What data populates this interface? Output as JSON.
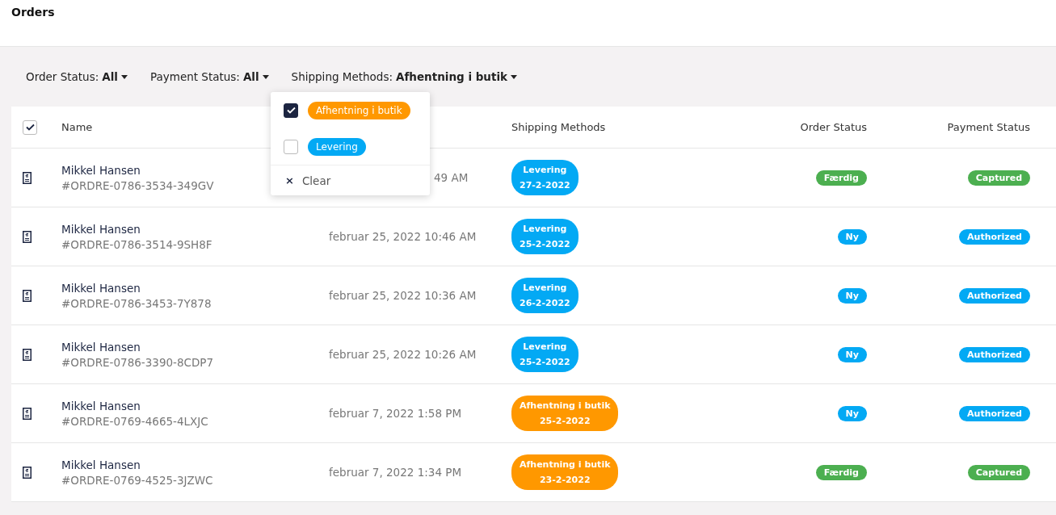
{
  "title": "Orders",
  "filters": [
    {
      "label": "Order Status:",
      "value": "All"
    },
    {
      "label": "Payment Status:",
      "value": "All"
    },
    {
      "label": "Shipping Methods:",
      "value": "Afhentning i butik"
    }
  ],
  "dropdown": {
    "options": [
      {
        "label": "Afhentning i butik",
        "checked": true,
        "color": "#ff9800"
      },
      {
        "label": "Levering",
        "checked": false,
        "color": "#03a9f4"
      }
    ],
    "clear": {
      "icon": "×",
      "label": "Clear"
    }
  },
  "table": {
    "select_all": {
      "checked": true
    },
    "columns": [
      "Name",
      "Shipping Methods",
      "Order Status",
      "Payment Status"
    ],
    "rows": [
      {
        "name": "Mikkel Hansen",
        "order": "#ORDRE-0786-3534-349GV",
        "date": "49 AM",
        "date_cut": true,
        "shipping": {
          "method": "Levering",
          "date": "27-2-2022",
          "color": "#03a9f4"
        },
        "order_status": {
          "label": "Færdig",
          "color": "#4caf50"
        },
        "payment_status": {
          "label": "Captured",
          "color": "#4caf50"
        }
      },
      {
        "name": "Mikkel Hansen",
        "order": "#ORDRE-0786-3514-9SH8F",
        "date": "februar 25, 2022 10:46 AM",
        "date_cut": false,
        "shipping": {
          "method": "Levering",
          "date": "25-2-2022",
          "color": "#03a9f4"
        },
        "order_status": {
          "label": "Ny",
          "color": "#03a9f4"
        },
        "payment_status": {
          "label": "Authorized",
          "color": "#03a9f4"
        }
      },
      {
        "name": "Mikkel Hansen",
        "order": "#ORDRE-0786-3453-7Y878",
        "date": "februar 25, 2022 10:36 AM",
        "date_cut": false,
        "shipping": {
          "method": "Levering",
          "date": "26-2-2022",
          "color": "#03a9f4"
        },
        "order_status": {
          "label": "Ny",
          "color": "#03a9f4"
        },
        "payment_status": {
          "label": "Authorized",
          "color": "#03a9f4"
        }
      },
      {
        "name": "Mikkel Hansen",
        "order": "#ORDRE-0786-3390-8CDP7",
        "date": "februar 25, 2022 10:26 AM",
        "date_cut": false,
        "shipping": {
          "method": "Levering",
          "date": "25-2-2022",
          "color": "#03a9f4"
        },
        "order_status": {
          "label": "Ny",
          "color": "#03a9f4"
        },
        "payment_status": {
          "label": "Authorized",
          "color": "#03a9f4"
        }
      },
      {
        "name": "Mikkel Hansen",
        "order": "#ORDRE-0769-4665-4LXJC",
        "date": "februar 7, 2022 1:58 PM",
        "date_cut": false,
        "shipping": {
          "method": "Afhentning i butik",
          "date": "25-2-2022",
          "color": "#ff9800"
        },
        "order_status": {
          "label": "Ny",
          "color": "#03a9f4"
        },
        "payment_status": {
          "label": "Authorized",
          "color": "#03a9f4"
        }
      },
      {
        "name": "Mikkel Hansen",
        "order": "#ORDRE-0769-4525-3JZWC",
        "date": "februar 7, 2022 1:34 PM",
        "date_cut": false,
        "shipping": {
          "method": "Afhentning i butik",
          "date": "23-2-2022",
          "color": "#ff9800"
        },
        "order_status": {
          "label": "Færdig",
          "color": "#4caf50"
        },
        "payment_status": {
          "label": "Captured",
          "color": "#4caf50"
        }
      }
    ]
  }
}
